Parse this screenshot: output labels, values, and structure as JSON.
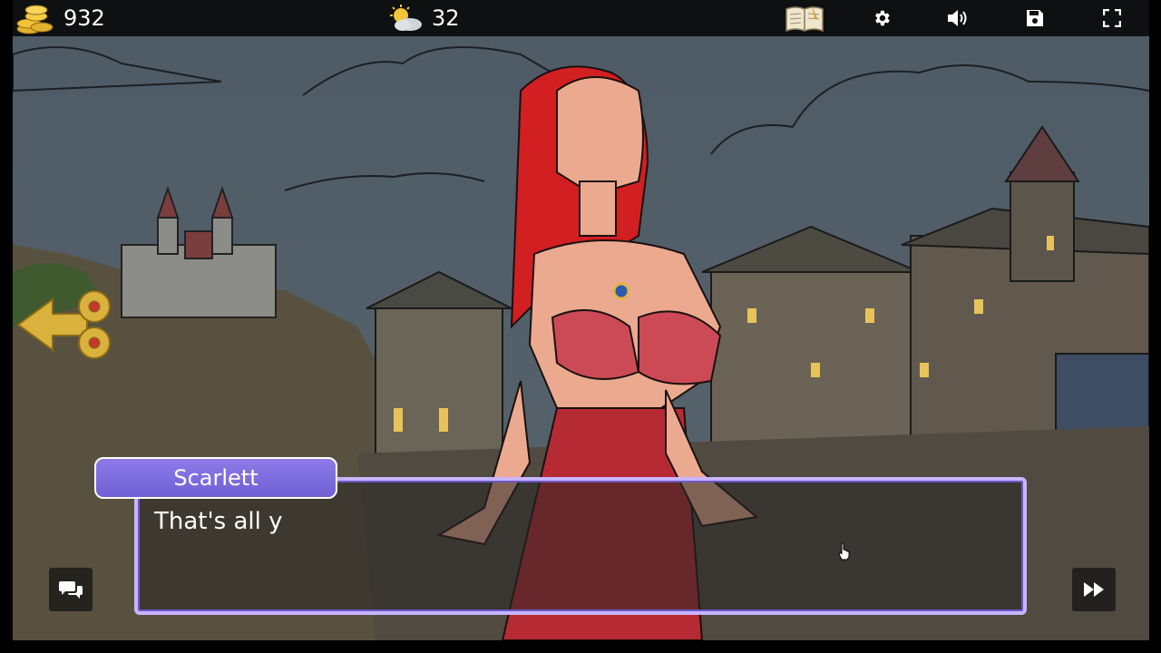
{
  "hud": {
    "gold": "932",
    "day": "32",
    "icons": [
      "coins-icon",
      "weather-icon",
      "journal-icon",
      "settings-icon",
      "volume-icon",
      "save-icon",
      "fullscreen-icon"
    ]
  },
  "dialog": {
    "speaker": "Scarlett",
    "text": "That's all y"
  },
  "colors": {
    "dialog_border": "#c8b4ff",
    "name_plate": "#7f6de0",
    "hair": "#d01f1f",
    "sky": "#4c5a66"
  }
}
